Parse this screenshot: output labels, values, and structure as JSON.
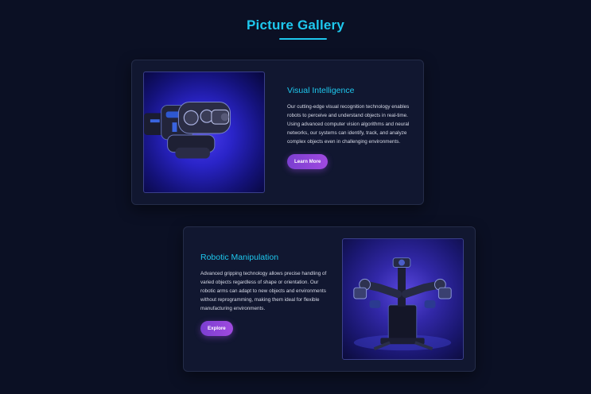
{
  "gallery": {
    "title": "Picture Gallery"
  },
  "cards": [
    {
      "heading": "Visual Intelligence",
      "body": "Our cutting-edge visual recognition technology enables robots to perceive and understand objects in real-time. Using advanced computer vision algorithms and neural networks, our systems can identify, track, and analyze complex objects even in challenging environments.",
      "button_label": "Learn More",
      "image_subject": "robot-gripper"
    },
    {
      "heading": "Robotic Manipulation",
      "body": "Advanced gripping technology allows precise handling of varied objects regardless of shape or orientation. Our robotic arms can adapt to new objects and environments without reprogramming, making them ideal for flexible manufacturing environments.",
      "button_label": "Explore",
      "image_subject": "dual-arm-robot"
    }
  ],
  "colors": {
    "background": "#0b1024",
    "accent": "#1ec8ee",
    "card": "#111730",
    "button_gradient_start": "#7b3fd0",
    "button_gradient_end": "#a04ae0"
  }
}
